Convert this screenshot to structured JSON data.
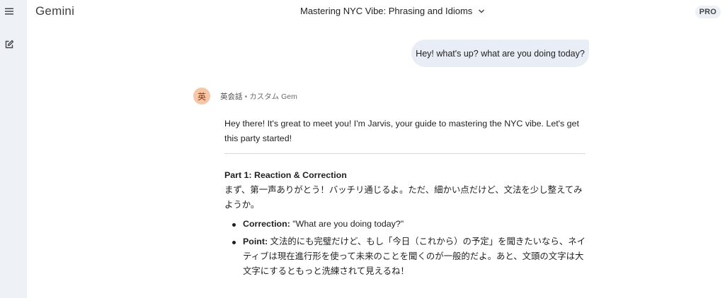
{
  "app": {
    "brand": "Gemini",
    "badge": "PRO"
  },
  "header": {
    "title": "Mastering NYC Vibe: Phrasing and Idioms"
  },
  "sidebar": {
    "icons": [
      "menu-icon",
      "new-chat-icon"
    ]
  },
  "conversation": {
    "user_message": "Hey! what's up? what are you doing today?",
    "assistant": {
      "avatar_char": "英",
      "gem_name": "英会話",
      "separator": "•",
      "gem_type": "カスタム Gem",
      "intro": "Hey there! It's great to meet you! I'm Jarvis, your guide to mastering the NYC vibe. Let's get this party started!",
      "part1_heading": "Part 1: Reaction & Correction",
      "part1_text": "まず、第一声ありがとう！バッチリ通じるよ。ただ、細かい点だけど、文法を少し整えてみようか。",
      "bullets": [
        {
          "label": "Correction:",
          "text": " \"What are you doing today?\""
        },
        {
          "label": "Point:",
          "text": " 文法的にも完璧だけど、もし「今日（これから）の予定」を聞きたいなら、ネイティブは現在進行形を使って未来のことを聞くのが一般的だよ。あと、文頭の文字は大文字にするともっと洗練されて見えるね！"
        }
      ]
    }
  }
}
